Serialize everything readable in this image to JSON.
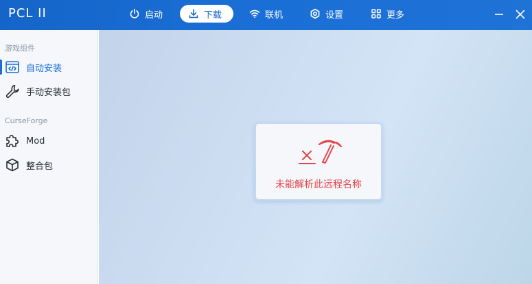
{
  "app": {
    "title": "PCL II"
  },
  "nav": {
    "launch": "启动",
    "download": "下载",
    "online": "联机",
    "settings": "设置",
    "more": "更多"
  },
  "sidebar": {
    "section_game": "游戏组件",
    "auto_install": "自动安装",
    "manual_install": "手动安装包",
    "section_curseforge": "CurseForge",
    "mod": "Mod",
    "modpack": "整合包"
  },
  "error": {
    "message": "未能解析此远程名称"
  },
  "colors": {
    "accent": "#1a6fd6",
    "titlebar": "#1565c9",
    "error": "#e0474c"
  }
}
